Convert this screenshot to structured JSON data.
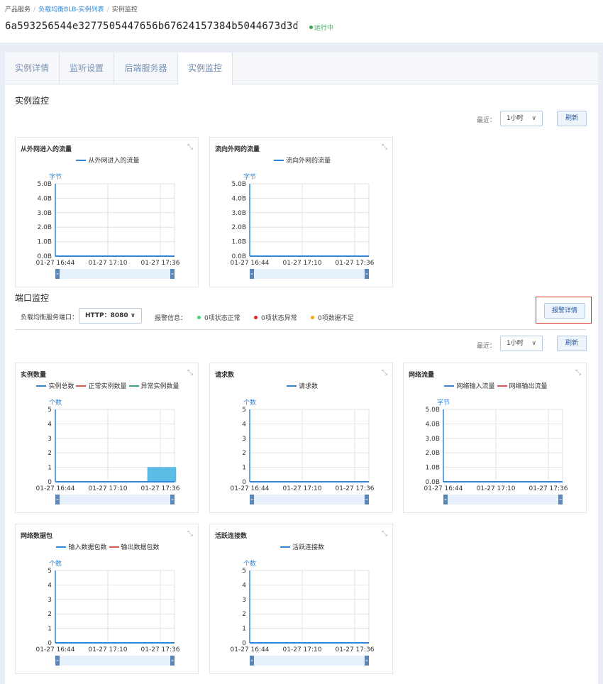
{
  "breadcrumb": {
    "root": "产品服务",
    "parent": "负载均衡BLB-实例列表",
    "current": "实例监控"
  },
  "instance": {
    "id": "6a593256544e3277505447656b67624157384b5044673d3d",
    "status": "运行中"
  },
  "tabs": [
    {
      "label": "实例详情"
    },
    {
      "label": "监听设置"
    },
    {
      "label": "后端服务器"
    },
    {
      "label": "实例监控",
      "active": true
    }
  ],
  "instance_monitor": {
    "title": "实例监控",
    "recent_label": "最近：",
    "range": "1小时",
    "refresh": "刷新"
  },
  "port_monitor": {
    "title": "端口监控",
    "port_label": "负载均衡服务端口：",
    "port_value": "HTTP：8080",
    "alarm_label": "报警信息：",
    "alarm_normal": "0项状态正常",
    "alarm_abnormal": "0项状态异常",
    "alarm_insufficient": "0项数据不足",
    "alarm_detail": "报警详情",
    "recent_label": "最近：",
    "range": "1小时",
    "refresh": "刷新"
  },
  "icons": {
    "expand": "expand-icon",
    "dropdown": "chevron-down-icon"
  },
  "colors": {
    "series_blue": "#2f86d8",
    "series_red": "#e0574f",
    "series_teal": "#35a58f",
    "status_green": "#3ea55c",
    "alarm_green": "#4ad07a",
    "alarm_red": "#e02020",
    "alarm_orange": "#f5a623",
    "bar_fill": "#5bbde6"
  },
  "chart_data": [
    {
      "type": "line",
      "title": "从外网进入的流量",
      "ylabel": "字节",
      "series": [
        {
          "name": "从外网进入的流量",
          "color": "#2f86d8",
          "values": [
            0,
            0,
            0
          ]
        }
      ],
      "x": [
        "01-27 16:44",
        "01-27 17:10",
        "01-27 17:36"
      ],
      "yticks": [
        "5.0B",
        "4.0B",
        "3.0B",
        "2.0B",
        "1.0B",
        "0.0B"
      ],
      "ylim": [
        0,
        5
      ]
    },
    {
      "type": "line",
      "title": "流向外网的流量",
      "ylabel": "字节",
      "series": [
        {
          "name": "流向外网的流量",
          "color": "#2f86d8",
          "values": [
            0,
            0,
            0
          ]
        }
      ],
      "x": [
        "01-27 16:44",
        "01-27 17:10",
        "01-27 17:36"
      ],
      "yticks": [
        "5.0B",
        "4.0B",
        "3.0B",
        "2.0B",
        "1.0B",
        "0.0B"
      ],
      "ylim": [
        0,
        5
      ]
    },
    {
      "type": "bar",
      "title": "实例数量",
      "ylabel": "个数",
      "series": [
        {
          "name": "实例总数",
          "color": "#2f86d8",
          "values": [
            0,
            0,
            1
          ]
        },
        {
          "name": "正常实例数量",
          "color": "#e0574f",
          "values": [
            0,
            0,
            0
          ]
        },
        {
          "name": "异常实例数量",
          "color": "#35a58f",
          "values": [
            0,
            0,
            0
          ]
        }
      ],
      "x": [
        "01-27 16:44",
        "01-27 17:10",
        "01-27 17:36"
      ],
      "yticks": [
        "5",
        "4",
        "3",
        "2",
        "1",
        "0"
      ],
      "ylim": [
        0,
        5
      ]
    },
    {
      "type": "line",
      "title": "请求数",
      "ylabel": "个数",
      "series": [
        {
          "name": "请求数",
          "color": "#2f86d8",
          "values": [
            0,
            0,
            0
          ]
        }
      ],
      "x": [
        "01-27 16:44",
        "01-27 17:10",
        "01-27 17:36"
      ],
      "yticks": [
        "5",
        "4",
        "3",
        "2",
        "1",
        "0"
      ],
      "ylim": [
        0,
        5
      ]
    },
    {
      "type": "line",
      "title": "网络流量",
      "ylabel": "字节",
      "series": [
        {
          "name": "网络输入流量",
          "color": "#2f86d8",
          "values": [
            0,
            0,
            0
          ]
        },
        {
          "name": "网络输出流量",
          "color": "#e0574f",
          "values": [
            0,
            0,
            0
          ]
        }
      ],
      "x": [
        "01-27 16:44",
        "01-27 17:10",
        "01-27 17:36"
      ],
      "yticks": [
        "5.0B",
        "4.0B",
        "3.0B",
        "2.0B",
        "1.0B",
        "0.0B"
      ],
      "ylim": [
        0,
        5
      ]
    },
    {
      "type": "line",
      "title": "网络数据包",
      "ylabel": "个数",
      "series": [
        {
          "name": "输入数据包数",
          "color": "#2f86d8",
          "values": [
            0,
            0,
            0
          ]
        },
        {
          "name": "输出数据包数",
          "color": "#e0574f",
          "values": [
            0,
            0,
            0
          ]
        }
      ],
      "x": [
        "01-27 16:44",
        "01-27 17:10",
        "01-27 17:36"
      ],
      "yticks": [
        "5",
        "4",
        "3",
        "2",
        "1",
        "0"
      ],
      "ylim": [
        0,
        5
      ]
    },
    {
      "type": "line",
      "title": "活跃连接数",
      "ylabel": "个数",
      "series": [
        {
          "name": "活跃连接数",
          "color": "#2f86d8",
          "values": [
            0,
            0,
            0
          ]
        }
      ],
      "x": [
        "01-27 16:44",
        "01-27 17:10",
        "01-27 17:36"
      ],
      "yticks": [
        "5",
        "4",
        "3",
        "2",
        "1",
        "0"
      ],
      "ylim": [
        0,
        5
      ]
    }
  ]
}
